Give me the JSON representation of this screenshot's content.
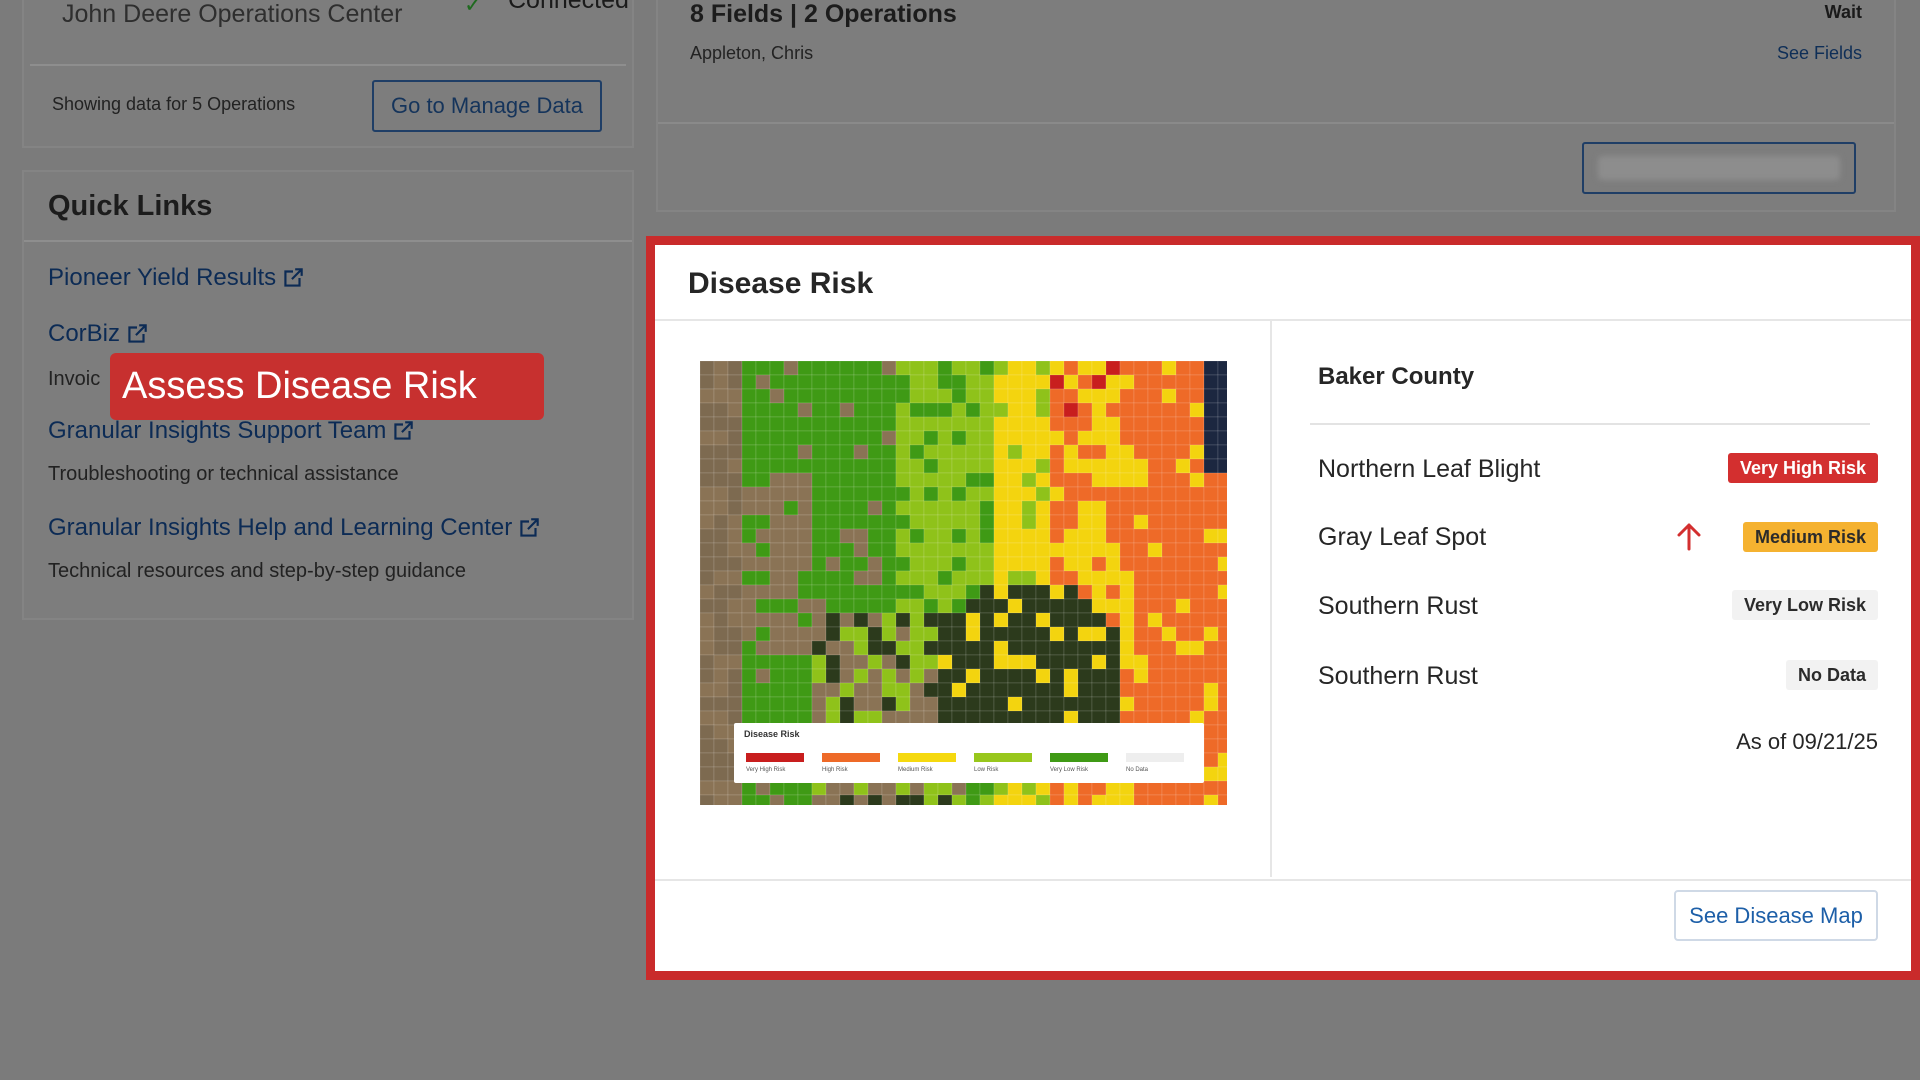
{
  "operations_card": {
    "title": "John Deere Operations Center",
    "status": "Connected",
    "showing": "Showing data for 5 Operations",
    "manage_button": "Go to Manage Data"
  },
  "quick_links": {
    "title": "Quick Links",
    "items": [
      {
        "label": "Pioneer Yield Results",
        "description": ""
      },
      {
        "label": "CorBiz",
        "description": "Invoic"
      },
      {
        "label": "Granular Insights Support Team",
        "description": "Troubleshooting or technical assistance"
      },
      {
        "label": "Granular Insights Help and Learning Center",
        "description": "Technical resources and step-by-step guidance"
      }
    ]
  },
  "callout": {
    "text": "Assess Disease Risk"
  },
  "fields_card": {
    "title": "8 Fields | 2 Operations",
    "status": "Wait",
    "owner": "Appleton, Chris",
    "link": "See Fields"
  },
  "disease_risk": {
    "title": "Disease Risk",
    "county": "Baker County",
    "diseases": [
      {
        "name": "Northern Leaf Blight",
        "risk": "Very High Risk",
        "badge_bg": "#d32f2f",
        "badge_fg": "#ffffff",
        "trend_icon": ""
      },
      {
        "name": "Gray Leaf Spot",
        "risk": "Medium Risk",
        "badge_bg": "#f5b230",
        "badge_fg": "#2b2b2b",
        "trend_icon": "arrow-up-icon"
      },
      {
        "name": "Southern Rust",
        "risk": "Very Low Risk",
        "badge_bg": "#f2f2f2",
        "badge_fg": "#2b2b2b",
        "trend_icon": ""
      },
      {
        "name": "Southern Rust",
        "risk": "No Data",
        "badge_bg": "#f2f2f2",
        "badge_fg": "#2b2b2b",
        "trend_icon": ""
      }
    ],
    "as_of": "As of 09/21/25",
    "map_button": "See Disease Map",
    "legend": {
      "title": "Disease Risk",
      "items": [
        {
          "label": "Very High Risk",
          "color": "#c81e1e"
        },
        {
          "label": "High Risk",
          "color": "#ee6a28"
        },
        {
          "label": "Medium Risk",
          "color": "#f5d90f"
        },
        {
          "label": "Low Risk",
          "color": "#98c71c"
        },
        {
          "label": "Very Low Risk",
          "color": "#3f9a15"
        },
        {
          "label": "No Data",
          "color": "#eeeeee"
        }
      ]
    }
  },
  "colors": {
    "highlight": "#c92b2b",
    "link": "#0c2b55",
    "button_text": "#1d5fa8"
  }
}
